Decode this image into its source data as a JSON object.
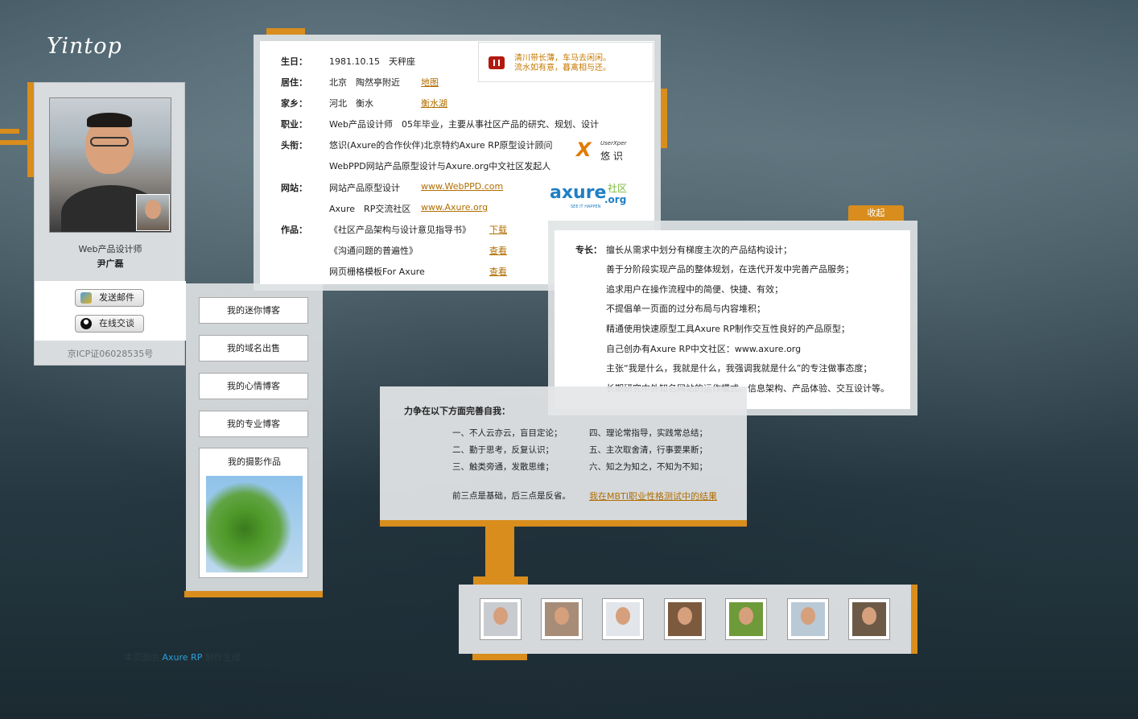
{
  "logo": "Yintop",
  "profile": {
    "role": "Web产品设计师",
    "name": "尹广磊",
    "email_button": "发送邮件",
    "chat_button": "在线交谈",
    "icp": "京ICP证06028535号"
  },
  "blogs": {
    "mini_blog": "我的迷你博客",
    "domain_sale": "我的域名出售",
    "mood_blog": "我的心情博客",
    "pro_blog": "我的专业博客",
    "photos": "我的摄影作品"
  },
  "info": {
    "birthday_label": "生日：",
    "birthday_value": "1981.10.15　天秤座",
    "residence_label": "居住：",
    "residence_value": "北京　陶然亭附近",
    "residence_link": "地图",
    "hometown_label": "家乡：",
    "hometown_value": "河北　衡水",
    "hometown_link": "衡水湖",
    "job_label": "职业：",
    "job_value": "Web产品设计师　05年毕业，主要从事社区产品的研究、规划、设计",
    "title_label": "头衔：",
    "title_line1": "悠识(Axure的合作伙伴)北京特约Axure RP原型设计顾问",
    "title_line2": "WebPPD网站产品原型设计与Axure.org中文社区发起人",
    "site_label": "网站：",
    "site1_name": "网站产品原型设计",
    "site1_link": "www.WebPPD.com",
    "site2_name": "Axure　RP交流社区",
    "site2_link": "www.Axure.org",
    "works_label": "作品：",
    "work1": "《社区产品架构与设计意见指导书》",
    "work1_link": "下载",
    "work2": "《沟通问题的普遍性》",
    "work2_link": "查看",
    "work3": "网页栅格模板For Axure",
    "work3_link": "查看"
  },
  "quote": {
    "line1": "清川带长薄，车马去闲闲。",
    "line2": "流水如有意，暮禽相与还。"
  },
  "logos": {
    "userxper_small": "UserXper",
    "userxper_cn": "悠 识",
    "axure_main": "axure",
    "axure_cn": "社区",
    "axure_tld": ".org",
    "axure_tag": "SEE IT HAPPEN"
  },
  "skills": {
    "collapse": "收起",
    "label": "专长：",
    "lines": [
      "擅长从需求中划分有梯度主次的产品结构设计；",
      "善于分阶段实现产品的整体规划，在迭代开发中完善产品服务；",
      "追求用户在操作流程中的简便、快捷、有效；",
      "不提倡单一页面的过分布局与内容堆积；",
      "精通使用快速原型工具Axure RP制作交互性良好的产品原型；",
      "自己创办有Axure RP中文社区：www.axure.org",
      "主张“我是什么，我就是什么，我强调我就是什么”的专注做事态度；",
      "长期研究中外知名网站的运作模式、信息架构、产品体验、交互设计等。"
    ]
  },
  "improve": {
    "title": "力争在以下方面完善自我：",
    "left": [
      "一、不人云亦云，盲目定论；",
      "二、勤于思考，反复认识；",
      "三、触类旁通，发散思维；"
    ],
    "right": [
      "四、理论常指导，实践常总结；",
      "五、主次取舍清，行事要果断；",
      "六、知之为知之，不知为不知；"
    ],
    "note": "前三点是基础，后三点是反省。",
    "mbti_link": "我在MBTI职业性格测试中的结果"
  },
  "friends": [
    {
      "icon": "friend-avatar-1",
      "color": "#c8ccd0"
    },
    {
      "icon": "friend-avatar-2",
      "color": "#a78d78"
    },
    {
      "icon": "friend-avatar-3",
      "color": "#e2e6ea"
    },
    {
      "icon": "friend-avatar-4",
      "color": "#7c5a3e"
    },
    {
      "icon": "friend-avatar-5",
      "color": "#6f9a3a"
    },
    {
      "icon": "friend-avatar-6",
      "color": "#b9c9d6"
    },
    {
      "icon": "friend-avatar-7",
      "color": "#6d5a46"
    }
  ],
  "footer": {
    "prefix": "本页面由",
    "tool": "Axure RP",
    "suffix": "制作生成"
  },
  "colors": {
    "accent_orange": "#d88d1c",
    "link_brown": "#b06e00",
    "quote_orange": "#c57900",
    "axure_blue": "#1f7fc4",
    "axure_green": "#7ab83a"
  }
}
